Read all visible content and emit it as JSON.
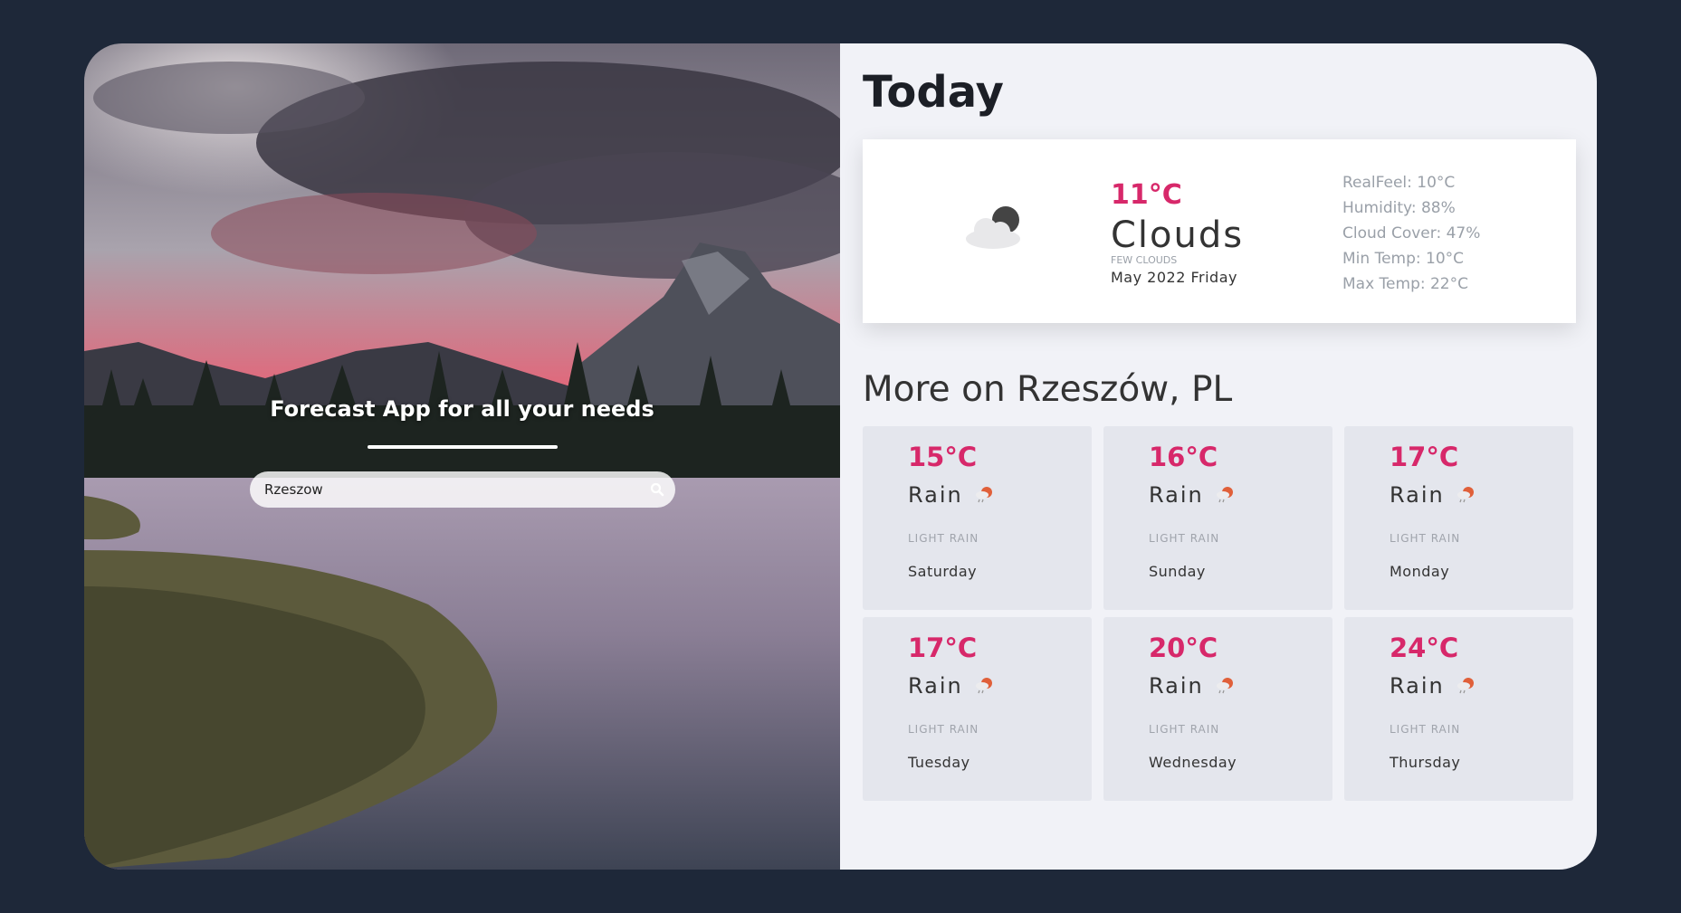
{
  "hero": {
    "tagline": "Forecast App for all your needs",
    "search": {
      "value": "Rzeszow",
      "placeholder": "",
      "icon": "search-icon"
    }
  },
  "today": {
    "heading": "Today",
    "icon": "partly-cloudy-icon",
    "temp": "11°C",
    "condition": "Clouds",
    "description": "few clouds",
    "date": "May 2022 Friday",
    "details": [
      "RealFeel: 10°C",
      "Humidity: 88%",
      "Cloud Cover: 47%",
      "Min Temp: 10°C",
      "Max Temp: 22°C"
    ]
  },
  "more": {
    "heading": "More on Rzeszów, PL",
    "days": [
      {
        "temp": "15°C",
        "condition": "Rain",
        "description": "light rain",
        "day": "Saturday",
        "icon": "rain-icon"
      },
      {
        "temp": "16°C",
        "condition": "Rain",
        "description": "light rain",
        "day": "Sunday",
        "icon": "rain-icon"
      },
      {
        "temp": "17°C",
        "condition": "Rain",
        "description": "light rain",
        "day": "Monday",
        "icon": "rain-icon"
      },
      {
        "temp": "17°C",
        "condition": "Rain",
        "description": "light rain",
        "day": "Tuesday",
        "icon": "rain-icon"
      },
      {
        "temp": "20°C",
        "condition": "Rain",
        "description": "light rain",
        "day": "Wednesday",
        "icon": "rain-icon"
      },
      {
        "temp": "24°C",
        "condition": "Rain",
        "description": "light rain",
        "day": "Thursday",
        "icon": "rain-icon"
      }
    ]
  },
  "colors": {
    "accent": "#d7286a",
    "background": "#1e2839",
    "panel": "#f1f2f7",
    "tile": "#e4e6ed"
  }
}
